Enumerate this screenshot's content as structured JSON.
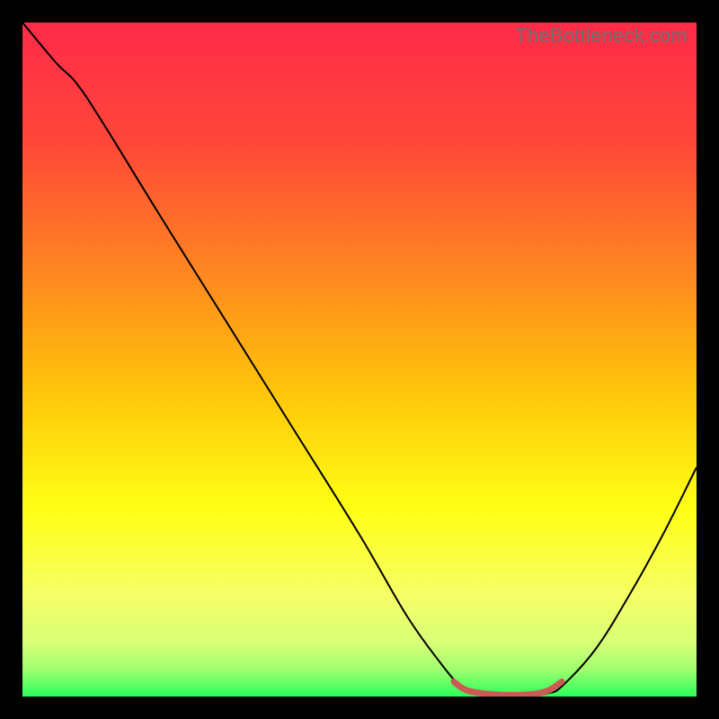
{
  "watermark": "TheBottleneck.com",
  "chart_data": {
    "type": "line",
    "title": "",
    "xlabel": "",
    "ylabel": "",
    "xlim": [
      0,
      100
    ],
    "ylim": [
      0,
      100
    ],
    "gradient_stops": [
      {
        "offset": 0,
        "color": "#ff2b49"
      },
      {
        "offset": 18,
        "color": "#ff4739"
      },
      {
        "offset": 38,
        "color": "#ff8a1f"
      },
      {
        "offset": 55,
        "color": "#ffc60a"
      },
      {
        "offset": 72,
        "color": "#ffff14"
      },
      {
        "offset": 85,
        "color": "#f6ff66"
      },
      {
        "offset": 92,
        "color": "#d8ff77"
      },
      {
        "offset": 96,
        "color": "#9fff6f"
      },
      {
        "offset": 100,
        "color": "#2aff5a"
      }
    ],
    "series": [
      {
        "name": "bottleneck-curve",
        "color": "#000000",
        "points": [
          {
            "x": 0,
            "y": 100
          },
          {
            "x": 5,
            "y": 94
          },
          {
            "x": 8,
            "y": 91
          },
          {
            "x": 12,
            "y": 85
          },
          {
            "x": 20,
            "y": 72
          },
          {
            "x": 30,
            "y": 56
          },
          {
            "x": 40,
            "y": 40
          },
          {
            "x": 50,
            "y": 24
          },
          {
            "x": 57,
            "y": 12
          },
          {
            "x": 62,
            "y": 5
          },
          {
            "x": 65,
            "y": 1.5
          },
          {
            "x": 67,
            "y": 0.5
          },
          {
            "x": 70,
            "y": 0
          },
          {
            "x": 75,
            "y": 0
          },
          {
            "x": 78,
            "y": 0.5
          },
          {
            "x": 80,
            "y": 1.5
          },
          {
            "x": 85,
            "y": 7
          },
          {
            "x": 90,
            "y": 15
          },
          {
            "x": 95,
            "y": 24
          },
          {
            "x": 100,
            "y": 34
          }
        ]
      },
      {
        "name": "flat-region-marker",
        "color": "#cc5a54",
        "stroke_width": 7,
        "points": [
          {
            "x": 64,
            "y": 2.2
          },
          {
            "x": 66,
            "y": 0.9
          },
          {
            "x": 70,
            "y": 0.3
          },
          {
            "x": 75,
            "y": 0.3
          },
          {
            "x": 78,
            "y": 0.9
          },
          {
            "x": 80,
            "y": 2.2
          }
        ]
      }
    ]
  }
}
